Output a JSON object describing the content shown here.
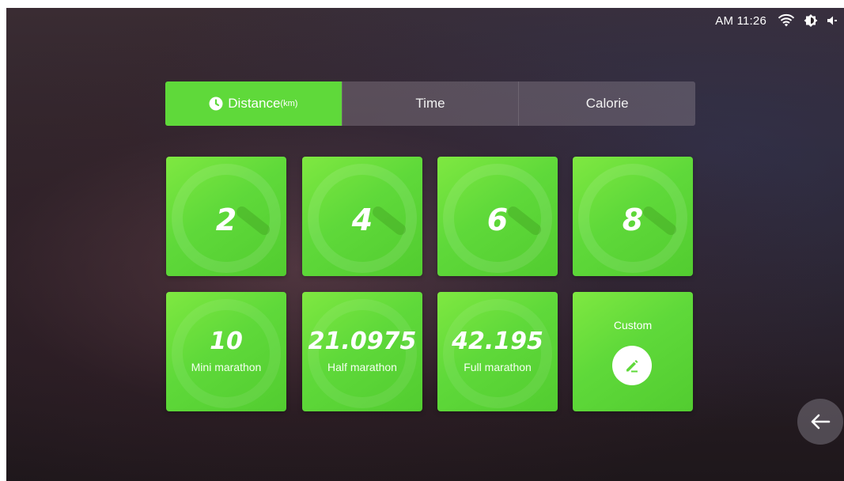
{
  "status_bar": {
    "time": "AM 11:26",
    "icons": [
      "wifi-icon",
      "brightness-icon",
      "volume-icon"
    ]
  },
  "tabs": [
    {
      "label": "Distance",
      "unit": "(km)",
      "active": true,
      "icon": "clock-icon"
    },
    {
      "label": "Time",
      "active": false
    },
    {
      "label": "Calorie",
      "active": false
    }
  ],
  "presets": [
    {
      "value": "2"
    },
    {
      "value": "4"
    },
    {
      "value": "6"
    },
    {
      "value": "8"
    },
    {
      "value": "10",
      "caption": "Mini marathon"
    },
    {
      "value": "21.0975",
      "caption": "Half marathon"
    },
    {
      "value": "42.195",
      "caption": "Full marathon"
    }
  ],
  "custom": {
    "label": "Custom",
    "icon": "edit-icon"
  },
  "back_button": {
    "icon": "back-arrow-icon"
  },
  "colors": {
    "accent_green": "#5fd93a",
    "tab_inactive": "#8c8390"
  }
}
